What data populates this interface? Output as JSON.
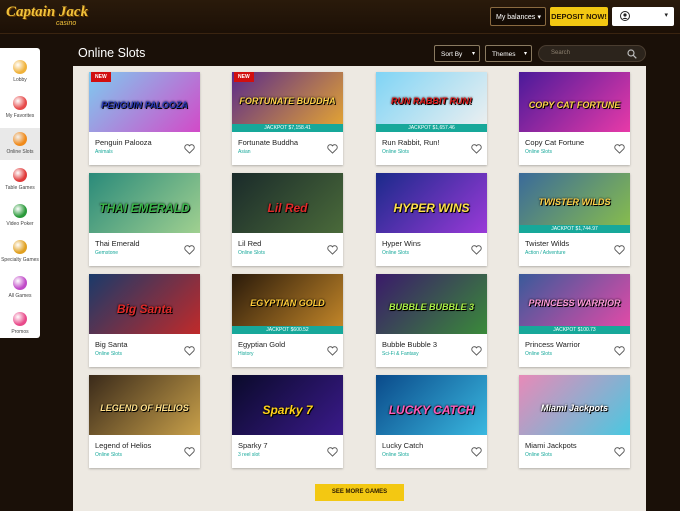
{
  "header": {
    "logo_text": "Captain Jack",
    "logo_sub": "casino",
    "balances_label": "My balances",
    "deposit_label": "DEPOSIT NOW!"
  },
  "sidebar": {
    "items": [
      {
        "label": "Lobby",
        "color": "#f0b23a"
      },
      {
        "label": "My Favorites",
        "color": "#e64a4a"
      },
      {
        "label": "Online Slots",
        "color": "#f08a1a"
      },
      {
        "label": "Table Games",
        "color": "#e03a3a"
      },
      {
        "label": "Video Poker",
        "color": "#2a9a3a"
      },
      {
        "label": "Specialty Games",
        "color": "#e0a020"
      },
      {
        "label": "All Games",
        "color": "#c04ac8"
      },
      {
        "label": "Promos",
        "color": "#e84a8a"
      }
    ]
  },
  "page": {
    "title": "Online Slots",
    "sort_label": "Sort By",
    "themes_label": "Themes",
    "search_placeholder": "Search"
  },
  "games": [
    {
      "name": "Penguin Palooza",
      "category": "Animals",
      "badge": "NEW",
      "art_title": "PENGUIN PALOOZA",
      "bg1": "#7ecbf0",
      "bg2": "#d24ac8",
      "title_color": "#2a3ab8"
    },
    {
      "name": "Fortunate Buddha",
      "category": "Asian",
      "badge": "NEW",
      "jackpot": "JACKPOT $7,158.41",
      "art_title": "FORTUNATE BUDDHA",
      "bg1": "#5a2a8a",
      "bg2": "#e8a830",
      "title_color": "#ffd24a"
    },
    {
      "name": "Run Rabbit, Run!",
      "category": "Online Slots",
      "jackpot": "JACKPOT $1,657.46",
      "art_title": "RUN RABBIT RUN!",
      "bg1": "#7fd4f5",
      "bg2": "#f0f0f0",
      "title_color": "#e01a1a"
    },
    {
      "name": "Copy Cat Fortune",
      "category": "Online Slots",
      "art_title": "COPY CAT FORTUNE",
      "bg1": "#4a1a9a",
      "bg2": "#e83aa8",
      "title_color": "#ffd24a"
    },
    {
      "name": "Thai Emerald",
      "category": "Gemstone",
      "art_title": "THAI EMERALD",
      "bg1": "#2a8a7a",
      "bg2": "#a0d090",
      "title_color": "#3ab84a"
    },
    {
      "name": "Lil Red",
      "category": "Online Slots",
      "art_title": "Lil Red",
      "bg1": "#1a2a2a",
      "bg2": "#4a6a3a",
      "title_color": "#e02a2a"
    },
    {
      "name": "Hyper Wins",
      "category": "Online Slots",
      "art_title": "HYPER WINS",
      "bg1": "#1a2a8a",
      "bg2": "#9a3ad8",
      "title_color": "#ffe04a"
    },
    {
      "name": "Twister Wilds",
      "category": "Action / Adventure",
      "jackpot": "JACKPOT $1,744.97",
      "art_title": "TWISTER WILDS",
      "bg1": "#3a6a9a",
      "bg2": "#8ac04a",
      "title_color": "#ffd24a"
    },
    {
      "name": "Big Santa",
      "category": "Online Slots",
      "art_title": "Big Santa",
      "bg1": "#1a3a6a",
      "bg2": "#c02a2a",
      "title_color": "#e02a2a"
    },
    {
      "name": "Egyptian Gold",
      "category": "History",
      "jackpot": "JACKPOT $600.52",
      "art_title": "EGYPTIAN GOLD",
      "bg1": "#2a1a0a",
      "bg2": "#c88a2a",
      "title_color": "#ffcc3a"
    },
    {
      "name": "Bubble Bubble 3",
      "category": "Sci-Fi & Fantasy",
      "art_title": "BUBBLE BUBBLE 3",
      "bg1": "#3a1a6a",
      "bg2": "#3a8a3a",
      "title_color": "#aaf04a"
    },
    {
      "name": "Princess Warrior",
      "category": "Online Slots",
      "jackpot": "JACKPOT $100.73",
      "art_title": "PRINCESS WARRIOR",
      "bg1": "#3a5a9a",
      "bg2": "#e84aa8",
      "title_color": "#ff9ad8"
    },
    {
      "name": "Legend of Helios",
      "category": "Online Slots",
      "art_title": "LEGEND OF HELIOS",
      "bg1": "#3a2a1a",
      "bg2": "#c8a04a",
      "title_color": "#ffe08a"
    },
    {
      "name": "Sparky 7",
      "category": "3 reel slot",
      "art_title": "Sparky 7",
      "bg1": "#0a0a2a",
      "bg2": "#3a1a8a",
      "title_color": "#ffd21a"
    },
    {
      "name": "Lucky Catch",
      "category": "Online Slots",
      "art_title": "LUCKY CATCH",
      "bg1": "#0a4a8a",
      "bg2": "#3ab8e0",
      "title_color": "#ff5ab8"
    },
    {
      "name": "Miami Jackpots",
      "category": "Online Slots",
      "art_title": "Miami Jackpots",
      "bg1": "#e88ab8",
      "bg2": "#4ac8e0",
      "title_color": "#ffffff"
    }
  ],
  "more_label": "SEE MORE GAMES"
}
